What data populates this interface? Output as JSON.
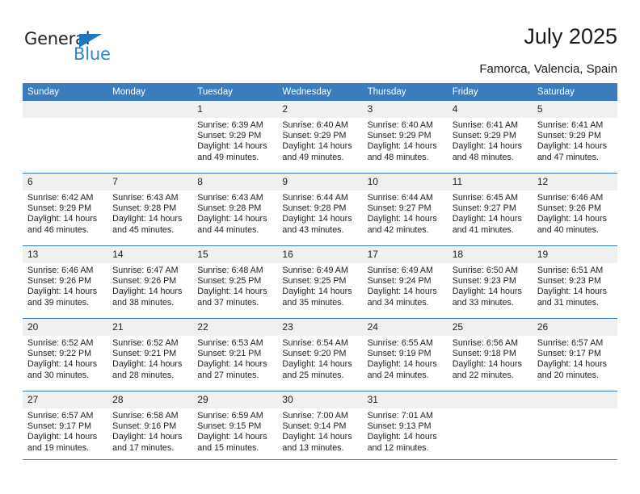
{
  "brand": {
    "name_top": "General",
    "name_bottom": "Blue",
    "triangle_color": "#1f78bd",
    "blue_color": "#2b87ce"
  },
  "header": {
    "title": "July 2025",
    "subtitle": "Famorca, Valencia, Spain"
  },
  "theme": {
    "header_band": "#3a7cbe",
    "daynum_band": "#f0f0f0",
    "text": "#1a1a1a"
  },
  "weekdays": [
    "Sunday",
    "Monday",
    "Tuesday",
    "Wednesday",
    "Thursday",
    "Friday",
    "Saturday"
  ],
  "weeks": [
    [
      {
        "day": "",
        "sunrise": "",
        "sunset": "",
        "daylight1": "",
        "daylight2": ""
      },
      {
        "day": "",
        "sunrise": "",
        "sunset": "",
        "daylight1": "",
        "daylight2": ""
      },
      {
        "day": "1",
        "sunrise": "Sunrise: 6:39 AM",
        "sunset": "Sunset: 9:29 PM",
        "daylight1": "Daylight: 14 hours",
        "daylight2": "and 49 minutes."
      },
      {
        "day": "2",
        "sunrise": "Sunrise: 6:40 AM",
        "sunset": "Sunset: 9:29 PM",
        "daylight1": "Daylight: 14 hours",
        "daylight2": "and 49 minutes."
      },
      {
        "day": "3",
        "sunrise": "Sunrise: 6:40 AM",
        "sunset": "Sunset: 9:29 PM",
        "daylight1": "Daylight: 14 hours",
        "daylight2": "and 48 minutes."
      },
      {
        "day": "4",
        "sunrise": "Sunrise: 6:41 AM",
        "sunset": "Sunset: 9:29 PM",
        "daylight1": "Daylight: 14 hours",
        "daylight2": "and 48 minutes."
      },
      {
        "day": "5",
        "sunrise": "Sunrise: 6:41 AM",
        "sunset": "Sunset: 9:29 PM",
        "daylight1": "Daylight: 14 hours",
        "daylight2": "and 47 minutes."
      }
    ],
    [
      {
        "day": "6",
        "sunrise": "Sunrise: 6:42 AM",
        "sunset": "Sunset: 9:29 PM",
        "daylight1": "Daylight: 14 hours",
        "daylight2": "and 46 minutes."
      },
      {
        "day": "7",
        "sunrise": "Sunrise: 6:43 AM",
        "sunset": "Sunset: 9:28 PM",
        "daylight1": "Daylight: 14 hours",
        "daylight2": "and 45 minutes."
      },
      {
        "day": "8",
        "sunrise": "Sunrise: 6:43 AM",
        "sunset": "Sunset: 9:28 PM",
        "daylight1": "Daylight: 14 hours",
        "daylight2": "and 44 minutes."
      },
      {
        "day": "9",
        "sunrise": "Sunrise: 6:44 AM",
        "sunset": "Sunset: 9:28 PM",
        "daylight1": "Daylight: 14 hours",
        "daylight2": "and 43 minutes."
      },
      {
        "day": "10",
        "sunrise": "Sunrise: 6:44 AM",
        "sunset": "Sunset: 9:27 PM",
        "daylight1": "Daylight: 14 hours",
        "daylight2": "and 42 minutes."
      },
      {
        "day": "11",
        "sunrise": "Sunrise: 6:45 AM",
        "sunset": "Sunset: 9:27 PM",
        "daylight1": "Daylight: 14 hours",
        "daylight2": "and 41 minutes."
      },
      {
        "day": "12",
        "sunrise": "Sunrise: 6:46 AM",
        "sunset": "Sunset: 9:26 PM",
        "daylight1": "Daylight: 14 hours",
        "daylight2": "and 40 minutes."
      }
    ],
    [
      {
        "day": "13",
        "sunrise": "Sunrise: 6:46 AM",
        "sunset": "Sunset: 9:26 PM",
        "daylight1": "Daylight: 14 hours",
        "daylight2": "and 39 minutes."
      },
      {
        "day": "14",
        "sunrise": "Sunrise: 6:47 AM",
        "sunset": "Sunset: 9:26 PM",
        "daylight1": "Daylight: 14 hours",
        "daylight2": "and 38 minutes."
      },
      {
        "day": "15",
        "sunrise": "Sunrise: 6:48 AM",
        "sunset": "Sunset: 9:25 PM",
        "daylight1": "Daylight: 14 hours",
        "daylight2": "and 37 minutes."
      },
      {
        "day": "16",
        "sunrise": "Sunrise: 6:49 AM",
        "sunset": "Sunset: 9:25 PM",
        "daylight1": "Daylight: 14 hours",
        "daylight2": "and 35 minutes."
      },
      {
        "day": "17",
        "sunrise": "Sunrise: 6:49 AM",
        "sunset": "Sunset: 9:24 PM",
        "daylight1": "Daylight: 14 hours",
        "daylight2": "and 34 minutes."
      },
      {
        "day": "18",
        "sunrise": "Sunrise: 6:50 AM",
        "sunset": "Sunset: 9:23 PM",
        "daylight1": "Daylight: 14 hours",
        "daylight2": "and 33 minutes."
      },
      {
        "day": "19",
        "sunrise": "Sunrise: 6:51 AM",
        "sunset": "Sunset: 9:23 PM",
        "daylight1": "Daylight: 14 hours",
        "daylight2": "and 31 minutes."
      }
    ],
    [
      {
        "day": "20",
        "sunrise": "Sunrise: 6:52 AM",
        "sunset": "Sunset: 9:22 PM",
        "daylight1": "Daylight: 14 hours",
        "daylight2": "and 30 minutes."
      },
      {
        "day": "21",
        "sunrise": "Sunrise: 6:52 AM",
        "sunset": "Sunset: 9:21 PM",
        "daylight1": "Daylight: 14 hours",
        "daylight2": "and 28 minutes."
      },
      {
        "day": "22",
        "sunrise": "Sunrise: 6:53 AM",
        "sunset": "Sunset: 9:21 PM",
        "daylight1": "Daylight: 14 hours",
        "daylight2": "and 27 minutes."
      },
      {
        "day": "23",
        "sunrise": "Sunrise: 6:54 AM",
        "sunset": "Sunset: 9:20 PM",
        "daylight1": "Daylight: 14 hours",
        "daylight2": "and 25 minutes."
      },
      {
        "day": "24",
        "sunrise": "Sunrise: 6:55 AM",
        "sunset": "Sunset: 9:19 PM",
        "daylight1": "Daylight: 14 hours",
        "daylight2": "and 24 minutes."
      },
      {
        "day": "25",
        "sunrise": "Sunrise: 6:56 AM",
        "sunset": "Sunset: 9:18 PM",
        "daylight1": "Daylight: 14 hours",
        "daylight2": "and 22 minutes."
      },
      {
        "day": "26",
        "sunrise": "Sunrise: 6:57 AM",
        "sunset": "Sunset: 9:17 PM",
        "daylight1": "Daylight: 14 hours",
        "daylight2": "and 20 minutes."
      }
    ],
    [
      {
        "day": "27",
        "sunrise": "Sunrise: 6:57 AM",
        "sunset": "Sunset: 9:17 PM",
        "daylight1": "Daylight: 14 hours",
        "daylight2": "and 19 minutes."
      },
      {
        "day": "28",
        "sunrise": "Sunrise: 6:58 AM",
        "sunset": "Sunset: 9:16 PM",
        "daylight1": "Daylight: 14 hours",
        "daylight2": "and 17 minutes."
      },
      {
        "day": "29",
        "sunrise": "Sunrise: 6:59 AM",
        "sunset": "Sunset: 9:15 PM",
        "daylight1": "Daylight: 14 hours",
        "daylight2": "and 15 minutes."
      },
      {
        "day": "30",
        "sunrise": "Sunrise: 7:00 AM",
        "sunset": "Sunset: 9:14 PM",
        "daylight1": "Daylight: 14 hours",
        "daylight2": "and 13 minutes."
      },
      {
        "day": "31",
        "sunrise": "Sunrise: 7:01 AM",
        "sunset": "Sunset: 9:13 PM",
        "daylight1": "Daylight: 14 hours",
        "daylight2": "and 12 minutes."
      },
      {
        "day": "",
        "sunrise": "",
        "sunset": "",
        "daylight1": "",
        "daylight2": ""
      },
      {
        "day": "",
        "sunrise": "",
        "sunset": "",
        "daylight1": "",
        "daylight2": ""
      }
    ]
  ]
}
